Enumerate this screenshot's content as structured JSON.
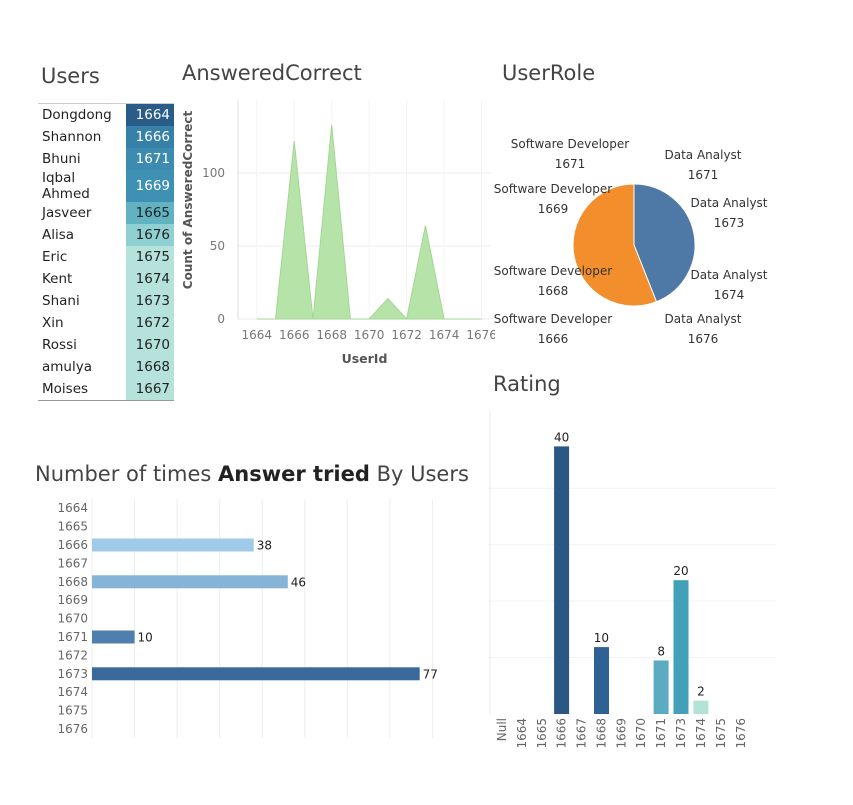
{
  "users": {
    "title": "Users",
    "rows": [
      {
        "name": "Dongdong",
        "id": "1664",
        "bg": "#2a5c8a",
        "fg": "#ffffff"
      },
      {
        "name": "Shannon",
        "id": "1666",
        "bg": "#3781a8",
        "fg": "#ffffff"
      },
      {
        "name": "Bhuni",
        "id": "1671",
        "bg": "#3d8bb0",
        "fg": "#ffffff"
      },
      {
        "name": "Iqbal Ahmed",
        "id": "1669",
        "bg": "#3f91b3",
        "fg": "#ffffff"
      },
      {
        "name": "Jasveer",
        "id": "1665",
        "bg": "#62b3c2",
        "fg": "#222222"
      },
      {
        "name": "Alisa",
        "id": "1676",
        "bg": "#8fd0d2",
        "fg": "#222222"
      },
      {
        "name": "Eric",
        "id": "1675",
        "bg": "#b5e3dc",
        "fg": "#222222"
      },
      {
        "name": "Kent",
        "id": "1674",
        "bg": "#b5e3dc",
        "fg": "#222222"
      },
      {
        "name": "Shani",
        "id": "1673",
        "bg": "#b5e3dc",
        "fg": "#222222"
      },
      {
        "name": "Xin",
        "id": "1672",
        "bg": "#b5e3dc",
        "fg": "#222222"
      },
      {
        "name": "Rossi",
        "id": "1670",
        "bg": "#b5e3dc",
        "fg": "#222222"
      },
      {
        "name": "amulya",
        "id": "1668",
        "bg": "#b5e3dc",
        "fg": "#222222"
      },
      {
        "name": "Moises",
        "id": "1667",
        "bg": "#b5e3dc",
        "fg": "#222222"
      }
    ]
  },
  "answered_correct": {
    "title": "AnsweredCorrect",
    "xlabel": "UserId",
    "ylabel": "Count of AnsweredCorrect",
    "yticks": [
      "100",
      "50",
      "0"
    ],
    "xticks": [
      "1664",
      "1666",
      "1668",
      "1670",
      "1672",
      "1674",
      "1676"
    ],
    "color": "#b6e3a8"
  },
  "user_role": {
    "title": "UserRole",
    "colors": {
      "Data Analyst": "#4e79a7",
      "Software Developer": "#f28e2b"
    },
    "labels": [
      {
        "role": "Software Developer",
        "id": "1671"
      },
      {
        "role": "Software Developer",
        "id": "1669"
      },
      {
        "role": "Software Developer",
        "id": "1668"
      },
      {
        "role": "Software Developer",
        "id": "1666"
      },
      {
        "role": "Data Analyst",
        "id": "1671"
      },
      {
        "role": "Data Analyst",
        "id": "1673"
      },
      {
        "role": "Data Analyst",
        "id": "1674"
      },
      {
        "role": "Data Analyst",
        "id": "1676"
      }
    ]
  },
  "answer_tried": {
    "title_prefix": "Number of times ",
    "title_bold": "Answer tried",
    "title_suffix": " By Users"
  },
  "rating": {
    "title": "Rating"
  },
  "chart_data": [
    {
      "type": "area",
      "title": "AnsweredCorrect",
      "xlabel": "UserId",
      "ylabel": "Count of AnsweredCorrect",
      "x": [
        1664,
        1665,
        1666,
        1667,
        1668,
        1669,
        1670,
        1671,
        1672,
        1673,
        1674,
        1675,
        1676
      ],
      "values": [
        0,
        0,
        122,
        0,
        133,
        0,
        0,
        14,
        0,
        64,
        0,
        0,
        0
      ],
      "xlim": [
        1663,
        1676.5
      ],
      "ylim": [
        0,
        150
      ],
      "grid": true
    },
    {
      "type": "pie",
      "title": "UserRole",
      "categories": [
        "Data Analyst",
        "Software Developer"
      ],
      "values": [
        44,
        56
      ]
    },
    {
      "type": "bar",
      "orientation": "horizontal",
      "title": "Number of times Answer tried By Users",
      "categories": [
        "1664",
        "1665",
        "1666",
        "1667",
        "1668",
        "1669",
        "1670",
        "1671",
        "1672",
        "1673",
        "1674",
        "1675",
        "1676"
      ],
      "values": [
        null,
        null,
        38,
        null,
        46,
        null,
        null,
        10,
        null,
        77,
        null,
        null,
        null
      ],
      "colors": [
        "",
        "",
        "#a0cbe8",
        "",
        "#86b3d8",
        "",
        "",
        "#4e7fae",
        "",
        "#3a6a9c",
        "",
        "",
        ""
      ],
      "xlim": [
        0,
        90
      ],
      "grid": true
    },
    {
      "type": "bar",
      "title": "Rating",
      "categories": [
        "Null",
        "1664",
        "1665",
        "1666",
        "1667",
        "1668",
        "1669",
        "1670",
        "1671",
        "1673",
        "1674",
        "1675",
        "1676"
      ],
      "values": [
        null,
        null,
        null,
        40,
        null,
        10,
        null,
        null,
        8,
        20,
        2,
        null,
        null
      ],
      "colors": [
        "",
        "",
        "",
        "#2a5783",
        "",
        "#2f6294",
        "",
        "",
        "#5bacc2",
        "#42a0b8",
        "#b3e2d6",
        "",
        ""
      ],
      "ylim": [
        0,
        45
      ],
      "grid": true
    }
  ]
}
